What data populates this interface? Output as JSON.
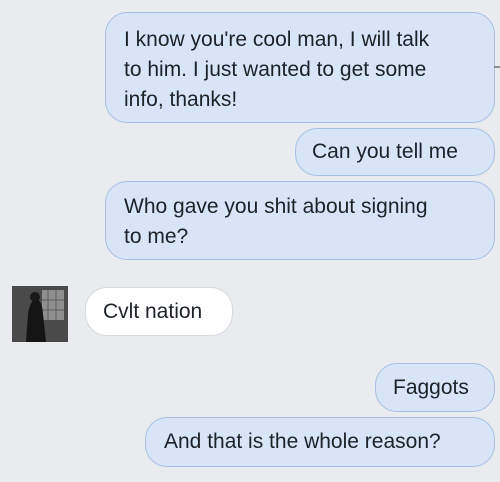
{
  "messages": [
    {
      "sender": "me",
      "lines": [
        "I know you're cool man, I will talk",
        "to him. I just wanted to get some",
        "info, thanks!"
      ]
    },
    {
      "sender": "me",
      "lines": [
        "Can you tell me"
      ]
    },
    {
      "sender": "me",
      "lines": [
        "Who gave you shit about signing",
        "to me?"
      ]
    },
    {
      "sender": "them",
      "lines": [
        "Cvlt nation"
      ]
    },
    {
      "sender": "me",
      "lines": [
        "Faggots"
      ]
    },
    {
      "sender": "me",
      "lines": [
        "And that is the whole reason?"
      ]
    }
  ],
  "colors": {
    "background": "#e9ebee",
    "outgoing_bubble": "#d8e5f9",
    "outgoing_border": "#a8c0e3",
    "incoming_bubble": "#ffffff",
    "incoming_border": "#d6d9de",
    "text": "#1d2129"
  }
}
